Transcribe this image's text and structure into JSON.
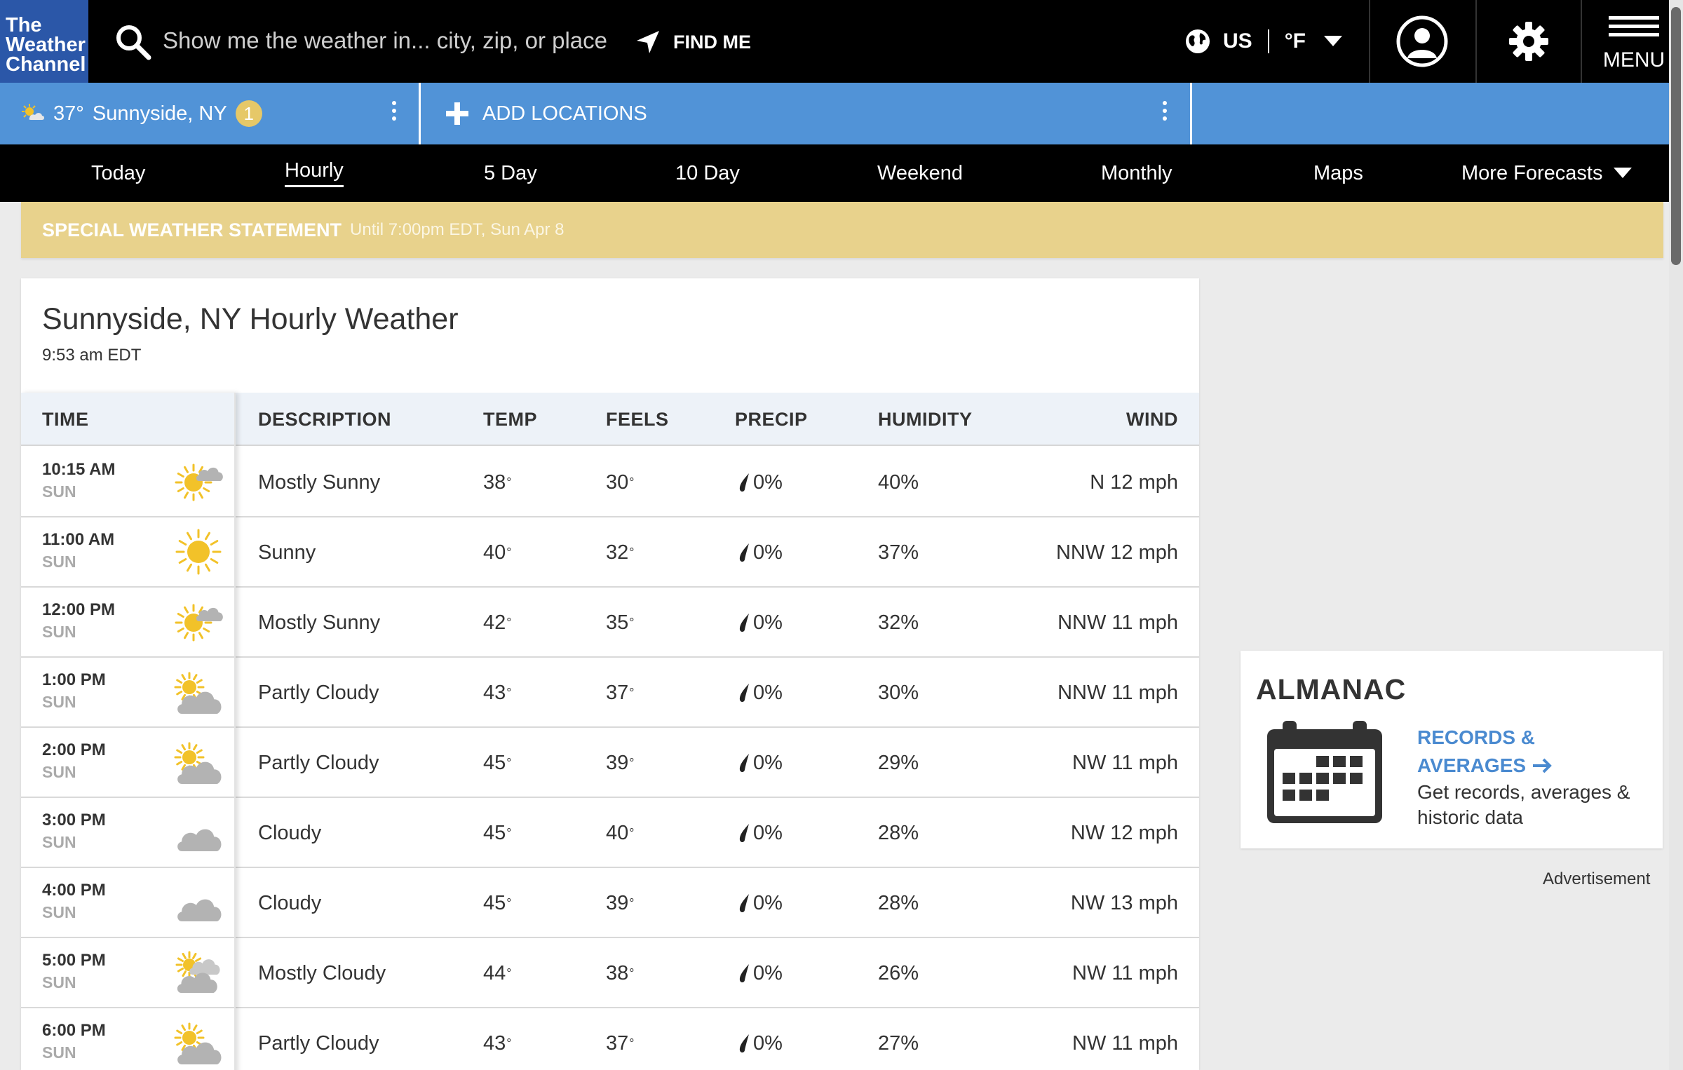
{
  "header": {
    "logo_lines": [
      "The",
      "Weather",
      "Channel"
    ],
    "search_placeholder": "Show me the weather in... city, zip, or place",
    "find_me_label": "FIND ME",
    "locale_country": "US",
    "locale_unit": "°F",
    "menu_label": "MENU"
  },
  "location_bar": {
    "current_temp": "37°",
    "current_location": "Sunnyside, NY",
    "badge_count": "1",
    "add_locations_label": "ADD LOCATIONS"
  },
  "tabs": [
    {
      "label": "Today"
    },
    {
      "label": "Hourly",
      "active": true
    },
    {
      "label": "5 Day"
    },
    {
      "label": "10 Day"
    },
    {
      "label": "Weekend"
    },
    {
      "label": "Monthly"
    },
    {
      "label": "Maps"
    },
    {
      "label": "More Forecasts"
    }
  ],
  "alert": {
    "title": "SPECIAL WEATHER STATEMENT",
    "subtitle": "Until 7:00pm EDT, Sun Apr 8"
  },
  "hourly": {
    "title": "Sunnyside, NY Hourly Weather",
    "timestamp": "9:53 am EDT",
    "columns": {
      "time": "TIME",
      "description": "DESCRIPTION",
      "temp": "TEMP",
      "feels": "FEELS",
      "precip": "PRECIP",
      "humidity": "HUMIDITY",
      "wind": "WIND"
    },
    "rows": [
      {
        "time": "10:15 AM",
        "day": "SUN",
        "icon": "mostly-sunny-icon",
        "description": "Mostly Sunny",
        "temp": "38",
        "feels": "30",
        "precip": "0%",
        "humidity": "40%",
        "wind": "N 12 mph"
      },
      {
        "time": "11:00 AM",
        "day": "SUN",
        "icon": "sunny-icon",
        "description": "Sunny",
        "temp": "40",
        "feels": "32",
        "precip": "0%",
        "humidity": "37%",
        "wind": "NNW 12 mph"
      },
      {
        "time": "12:00 PM",
        "day": "SUN",
        "icon": "mostly-sunny-icon",
        "description": "Mostly Sunny",
        "temp": "42",
        "feels": "35",
        "precip": "0%",
        "humidity": "32%",
        "wind": "NNW 11 mph"
      },
      {
        "time": "1:00 PM",
        "day": "SUN",
        "icon": "partly-cloudy-icon",
        "description": "Partly Cloudy",
        "temp": "43",
        "feels": "37",
        "precip": "0%",
        "humidity": "30%",
        "wind": "NNW 11 mph"
      },
      {
        "time": "2:00 PM",
        "day": "SUN",
        "icon": "partly-cloudy-icon",
        "description": "Partly Cloudy",
        "temp": "45",
        "feels": "39",
        "precip": "0%",
        "humidity": "29%",
        "wind": "NW 11 mph"
      },
      {
        "time": "3:00 PM",
        "day": "SUN",
        "icon": "cloudy-icon",
        "description": "Cloudy",
        "temp": "45",
        "feels": "40",
        "precip": "0%",
        "humidity": "28%",
        "wind": "NW 12 mph"
      },
      {
        "time": "4:00 PM",
        "day": "SUN",
        "icon": "cloudy-icon",
        "description": "Cloudy",
        "temp": "45",
        "feels": "39",
        "precip": "0%",
        "humidity": "28%",
        "wind": "NW 13 mph"
      },
      {
        "time": "5:00 PM",
        "day": "SUN",
        "icon": "mostly-cloudy-icon",
        "description": "Mostly Cloudy",
        "temp": "44",
        "feels": "38",
        "precip": "0%",
        "humidity": "26%",
        "wind": "NW 11 mph"
      },
      {
        "time": "6:00 PM",
        "day": "SUN",
        "icon": "partly-cloudy-icon",
        "description": "Partly Cloudy",
        "temp": "43",
        "feels": "37",
        "precip": "0%",
        "humidity": "27%",
        "wind": "NW 11 mph"
      }
    ]
  },
  "almanac": {
    "title": "ALMANAC",
    "link_label": "RECORDS & AVERAGES",
    "description": "Get records, averages & historic data"
  },
  "advertisement_label": "Advertisement",
  "colors": {
    "brand_blue": "#2b57a8",
    "location_bar": "#5193d7",
    "alert_yellow": "#e8d28c",
    "link_blue": "#4a8ad0",
    "sun_yellow": "#f2c229",
    "cloud_gray": "#b3b3b3"
  }
}
